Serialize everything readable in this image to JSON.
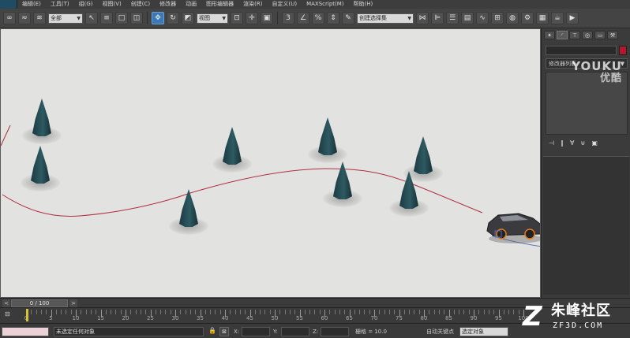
{
  "menubar": {
    "items": [
      "编辑(E)",
      "工具(T)",
      "组(G)",
      "视图(V)",
      "创建(C)",
      "修改器",
      "动画",
      "图形编辑器",
      "渲染(R)",
      "自定义(U)",
      "MAXScript(M)",
      "帮助(H)"
    ]
  },
  "toolbar": {
    "filter_select": "全部",
    "coord_select": "视图",
    "named_selection": "创建选择集"
  },
  "command_panel": {
    "modifier_list_label": "修改器列表",
    "swatch_color": "#b2182b"
  },
  "watermarks": {
    "youku_en": "YOUKU",
    "youku_cn": "优酷",
    "site_title": "朱峰社区",
    "site_url": "ZF3D.COM",
    "site_logo": "Z"
  },
  "timeline": {
    "frame_display": "0 / 100",
    "prev_arrow": "<",
    "next_arrow": ">",
    "ruler_labels": [
      "0",
      "5",
      "10",
      "15",
      "20",
      "25",
      "30",
      "35",
      "40",
      "45",
      "50",
      "55",
      "60",
      "65",
      "70",
      "75",
      "80",
      "85",
      "90",
      "95",
      "100"
    ]
  },
  "statusbar": {
    "status_text": "未选定任何对象",
    "x_label": "X:",
    "y_label": "Y:",
    "z_label": "Z:",
    "grid_text": "栅格 = 10.0",
    "autokey_label": "自动关键点",
    "selection_set": "选定对象"
  }
}
